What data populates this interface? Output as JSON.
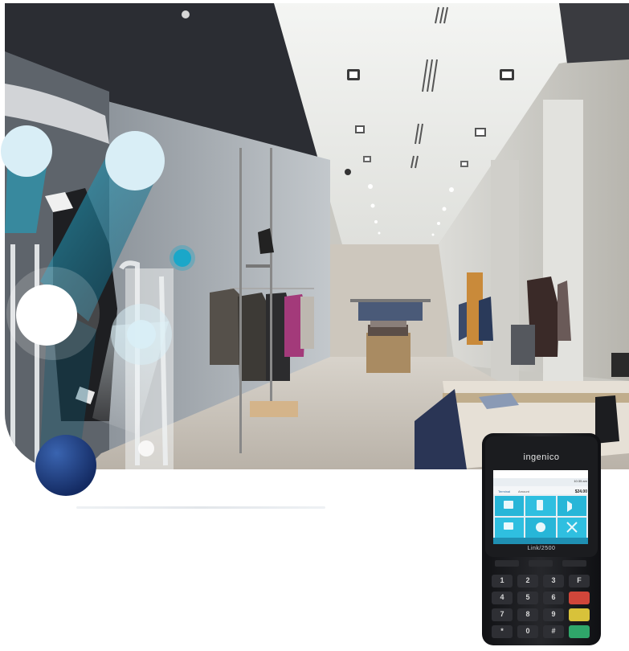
{
  "scene": {
    "description_type": "photo",
    "colors": {
      "accent_teal": "#1aa7c9",
      "bubble_light": "#d9eef6",
      "bubble_navy": "#1c3a7a",
      "device_body": "#1b1c1f",
      "screen_tile": "#27b6d8"
    }
  },
  "terminal": {
    "brand": "ingenico",
    "model": "Link/2500",
    "screen": {
      "time": "10:35 am",
      "amount": "$24.00",
      "left_label": "Terminal",
      "mid_label": "Amount"
    },
    "keys": [
      "1",
      "2",
      "3",
      "F",
      "4",
      "5",
      "6",
      "",
      "7",
      "8",
      "9",
      "",
      "*",
      "0",
      "#",
      ""
    ]
  }
}
